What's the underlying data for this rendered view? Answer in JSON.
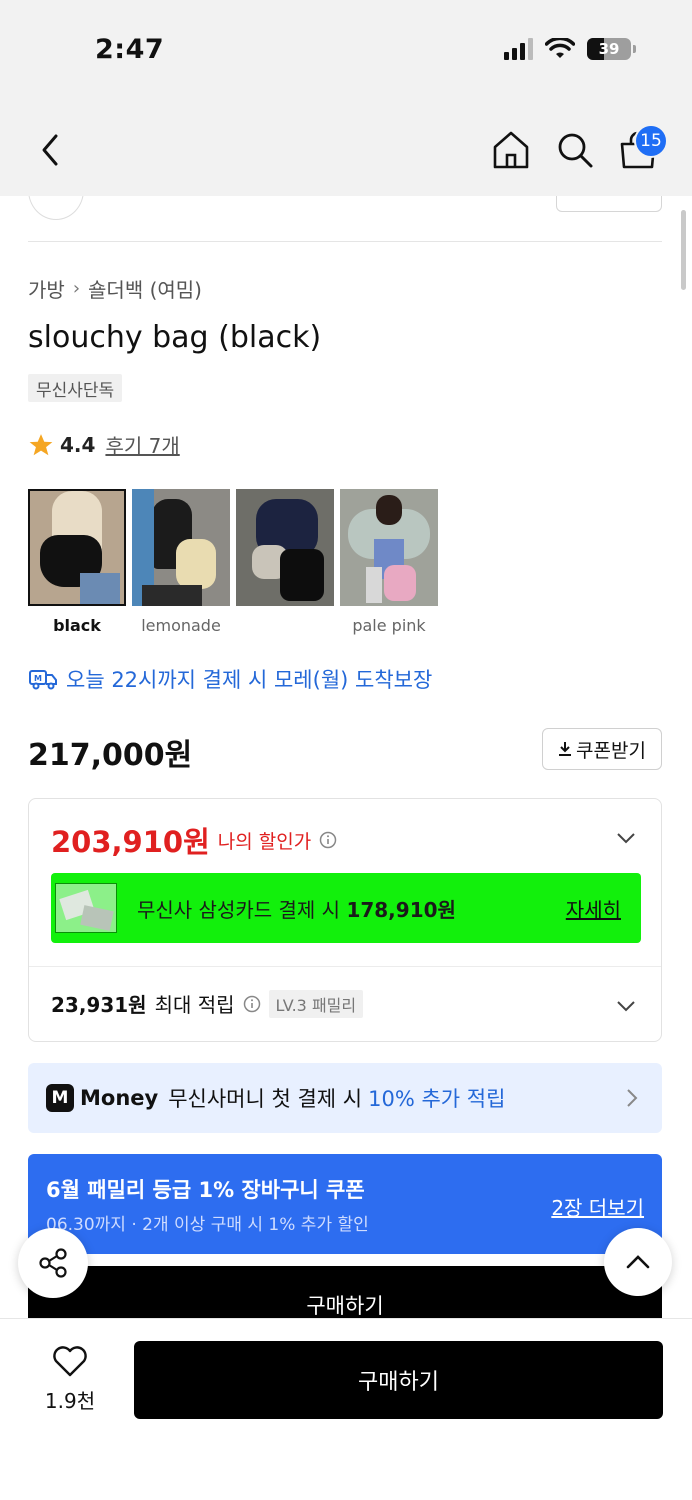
{
  "status": {
    "time": "2:47",
    "battery": "39"
  },
  "header": {
    "cart_count": "15"
  },
  "product": {
    "breadcrumb": [
      "가방",
      "숄더백 (여밈)"
    ],
    "title": "slouchy bag (black)",
    "exclusive_tag": "무신사단독",
    "rating": "4.4",
    "review_link": "후기 7개",
    "colors": [
      {
        "label": "black",
        "selected": true
      },
      {
        "label": "lemonade",
        "selected": false
      },
      {
        "label": "",
        "selected": false
      },
      {
        "label": "pale pink",
        "selected": false
      }
    ]
  },
  "delivery": {
    "text": "오늘 22시까지 결제 시 모레(월) 도착보장",
    "color": "#2468d8"
  },
  "price": {
    "original": "217,000원",
    "coupon_button": "쿠폰받기"
  },
  "benefits": {
    "my_price": "203,910원",
    "my_price_label": "나의 할인가",
    "card_text": "무신사 삼성카드 결제 시",
    "card_price": "178,910원",
    "card_detail": "자세히",
    "card_banner_color": "#12f00c",
    "points": "23,931원",
    "points_label": "최대 적립",
    "level": "LV.3 패밀리"
  },
  "money_banner": {
    "brand": "Money",
    "text": "무신사머니 첫 결제 시",
    "highlight": "10% 추가 적립"
  },
  "family_banner": {
    "title": "6월 패밀리 등급 1% 장바구니 쿠폰",
    "subtitle": "06.30까지 · 2개 이상 구매 시 1% 추가 할인",
    "more": "2장 더보기",
    "color": "#2d6df0"
  },
  "bottom_bar": {
    "like_count": "1.9천",
    "buy_label": "구매하기"
  },
  "icons": [
    "back-icon",
    "home-icon",
    "search-icon",
    "shopping-bag-icon",
    "star-icon",
    "delivery-truck-icon",
    "download-icon",
    "info-icon",
    "chevron-down-icon",
    "chevron-right-icon",
    "share-icon",
    "chevron-up-icon",
    "heart-icon"
  ]
}
